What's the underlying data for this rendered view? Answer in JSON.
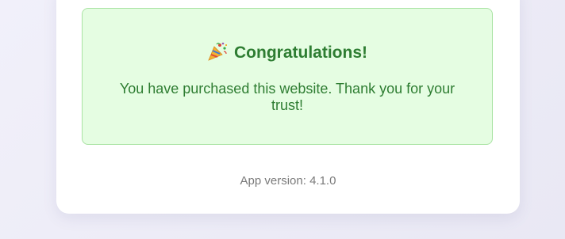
{
  "success": {
    "icon": "party-popper-icon",
    "title": "Congratulations!",
    "message": "You have purchased this website. Thank you for your trust!"
  },
  "footer": {
    "app_version": "App version: 4.1.0"
  },
  "colors": {
    "success_bg": "#e5fde2",
    "success_border": "#a9e3a3",
    "success_text": "#2e7d32",
    "muted_text": "#7a7a7a"
  }
}
